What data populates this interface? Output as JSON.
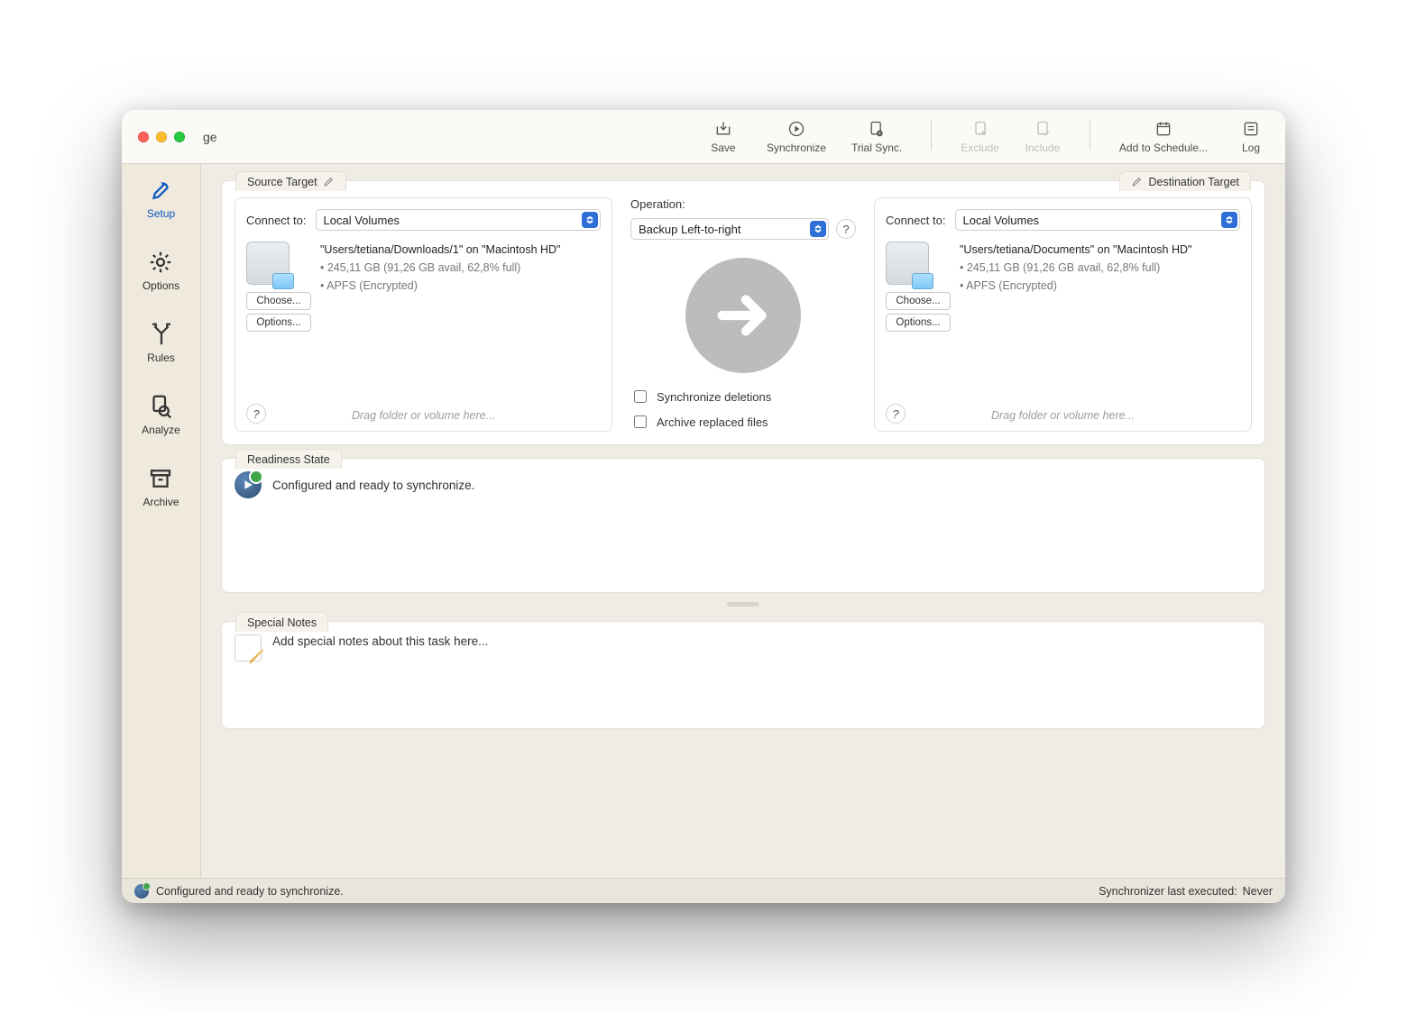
{
  "window": {
    "title": "ge"
  },
  "toolbar": {
    "save": "Save",
    "synchronize": "Synchronize",
    "trial_sync": "Trial Sync.",
    "exclude": "Exclude",
    "include": "Include",
    "add_schedule": "Add to Schedule...",
    "log": "Log"
  },
  "sidebar": {
    "setup": "Setup",
    "options": "Options",
    "rules": "Rules",
    "analyze": "Analyze",
    "archive": "Archive"
  },
  "targets": {
    "source_tab": "Source Target",
    "dest_tab": "Destination Target",
    "connect_to_label": "Connect to:",
    "drop_hint": "Drag folder or volume here...",
    "source": {
      "connect_value": "Local Volumes",
      "path": "\"Users/tetiana/Downloads/1\" on \"Macintosh HD\"",
      "meta1": "• 245,11 GB (91,26 GB avail, 62,8% full)",
      "meta2": "• APFS (Encrypted)",
      "choose": "Choose...",
      "options": "Options..."
    },
    "dest": {
      "connect_value": "Local Volumes",
      "path": "\"Users/tetiana/Documents\" on \"Macintosh HD\"",
      "meta1": "• 245,11 GB (91,26 GB avail, 62,8% full)",
      "meta2": "• APFS (Encrypted)",
      "choose": "Choose...",
      "options": "Options..."
    }
  },
  "operation": {
    "label": "Operation:",
    "value": "Backup Left-to-right",
    "sync_deletions": "Synchronize deletions",
    "archive_replaced": "Archive replaced files"
  },
  "readiness": {
    "tab": "Readiness State",
    "text": "Configured and ready to synchronize."
  },
  "notes": {
    "tab": "Special Notes",
    "text": "Add special notes about this task here..."
  },
  "footer": {
    "status": "Configured and ready to synchronize.",
    "last_label": "Synchronizer last executed:",
    "last_value": "Never"
  }
}
